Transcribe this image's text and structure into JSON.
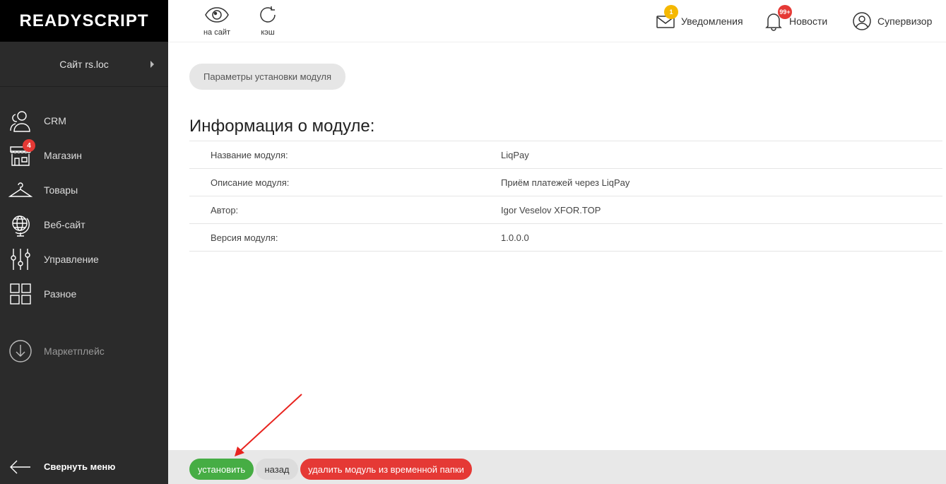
{
  "app": {
    "logo": "READYSCRIPT"
  },
  "sidebar": {
    "site": "Сайт rs.loc",
    "items": [
      {
        "label": "CRM",
        "icon": "users-icon"
      },
      {
        "label": "Магазин",
        "icon": "store-icon",
        "badge": "4"
      },
      {
        "label": "Товары",
        "icon": "hanger-icon"
      },
      {
        "label": "Веб-сайт",
        "icon": "globe-icon"
      },
      {
        "label": "Управление",
        "icon": "sliders-icon"
      },
      {
        "label": "Разное",
        "icon": "grid-icon"
      }
    ],
    "marketplace": "Маркетплейс",
    "collapse": "Свернуть меню"
  },
  "header": {
    "tools": [
      {
        "label": "на сайт",
        "icon": "eye-icon"
      },
      {
        "label": "кэш",
        "icon": "refresh-icon"
      }
    ],
    "notifications": {
      "label": "Уведомления",
      "badge": "1",
      "badge_color": "#f5b800"
    },
    "news": {
      "label": "Новости",
      "badge": "99+",
      "badge_color": "#e53935"
    },
    "user": {
      "label": "Супервизор"
    }
  },
  "main": {
    "tab": "Параметры установки модуля",
    "title": "Информация о модуле:",
    "rows": [
      {
        "key": "Название модуля:",
        "value": "LiqPay"
      },
      {
        "key": "Описание модуля:",
        "value": "Приём платежей через LiqPay"
      },
      {
        "key": "Автор:",
        "value": "Igor Veselov XFOR.TOP"
      },
      {
        "key": "Версия модуля:",
        "value": "1.0.0.0"
      }
    ]
  },
  "footer": {
    "install": "установить",
    "back": "назад",
    "delete": "удалить модуль из временной папки"
  },
  "colors": {
    "install": "#46ad44",
    "delete": "#e53935",
    "annotation_arrow": "#e8231e"
  }
}
